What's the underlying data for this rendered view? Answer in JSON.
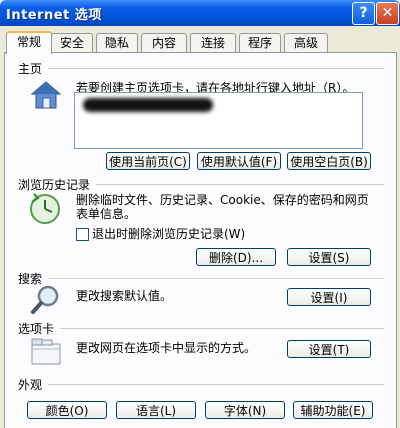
{
  "window": {
    "title": "Internet 选项",
    "help": "?",
    "close": "✕"
  },
  "tabs": [
    "常规",
    "安全",
    "隐私",
    "内容",
    "连接",
    "程序",
    "高级"
  ],
  "home": {
    "heading": "主页",
    "desc": "若要创建主页选项卡，请在各地址行键入地址（R）。",
    "buttons": [
      "使用当前页(C)",
      "使用默认值(F)",
      "使用空白页(B)"
    ]
  },
  "history": {
    "heading": "浏览历史记录",
    "desc_line1": "删除临时文件、历史记录、Cookie、保存的密码和网页",
    "desc_line2": "表单信息。",
    "checkbox_label": "退出时删除浏览历史记录(W)",
    "delete_button": "删除(D)...",
    "settings_button": "设置(S)"
  },
  "search": {
    "heading": "搜索",
    "desc": "更改搜索默认值。",
    "settings_button": "设置(I)"
  },
  "tabsection": {
    "heading": "选项卡",
    "desc": "更改网页在选项卡中显示的方式。",
    "settings_button": "设置(T)"
  },
  "appearance": {
    "heading": "外观",
    "buttons": [
      "颜色(O)",
      "语言(L)",
      "字体(N)",
      "辅助功能(E)"
    ]
  },
  "colors": {
    "titlebar": "#0454d8",
    "close": "#c6421e",
    "dialog_bg": "#ece9d8",
    "tab_highlight": "#f8b844"
  }
}
